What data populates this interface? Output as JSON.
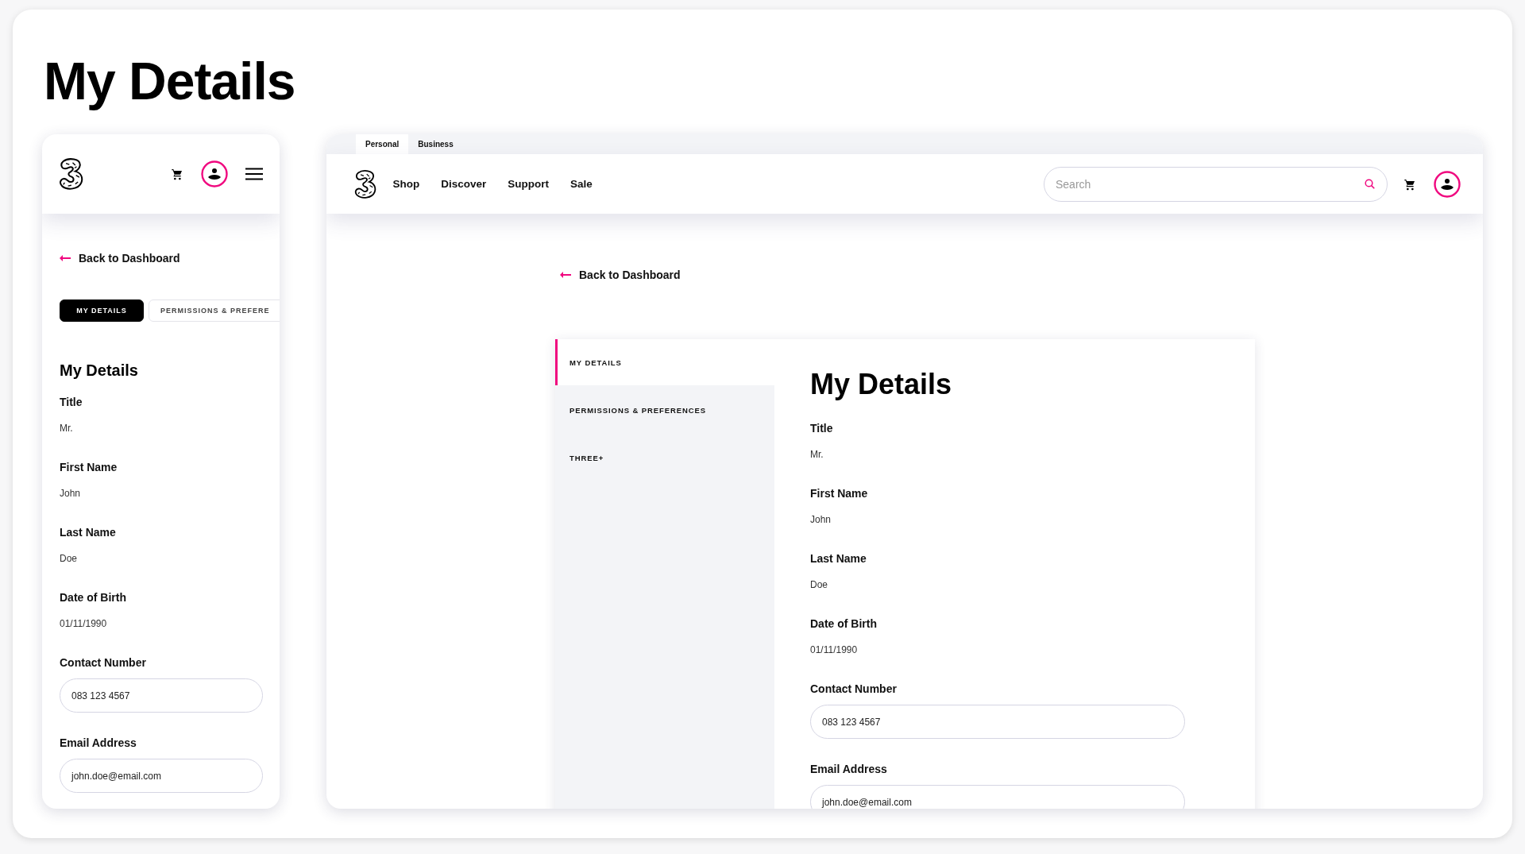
{
  "page_title": "My Details",
  "mobile": {
    "back_link": "Back to Dashboard",
    "tabs": [
      {
        "label": "MY DETAILS",
        "selected": true
      },
      {
        "label": "PERMISSIONS & PREFERE",
        "selected": false
      }
    ],
    "heading": "My Details",
    "fields": [
      {
        "kind": "text",
        "label": "Title",
        "value": "Mr."
      },
      {
        "kind": "text",
        "label": "First Name",
        "value": "John"
      },
      {
        "kind": "text",
        "label": "Last Name",
        "value": "Doe"
      },
      {
        "kind": "text",
        "label": "Date of Birth",
        "value": "01/11/1990"
      },
      {
        "kind": "input",
        "label": "Contact Number",
        "value": "083 123 4567"
      },
      {
        "kind": "input",
        "label": "Email Address",
        "value": "john.doe@email.com"
      }
    ]
  },
  "desktop": {
    "segments": [
      {
        "label": "Personal",
        "selected": true
      },
      {
        "label": "Business",
        "selected": false
      }
    ],
    "nav": [
      "Shop",
      "Discover",
      "Support",
      "Sale"
    ],
    "search": {
      "placeholder": "Search"
    },
    "back_link": "Back to Dashboard",
    "sidebar": [
      {
        "label": "MY DETAILS",
        "selected": true
      },
      {
        "label": "PERMISSIONS & PREFERENCES",
        "selected": false
      },
      {
        "label": "THREE+",
        "selected": false
      }
    ],
    "heading": "My Details",
    "fields": [
      {
        "kind": "text",
        "label": "Title",
        "value": "Mr."
      },
      {
        "kind": "text",
        "label": "First Name",
        "value": "John"
      },
      {
        "kind": "text",
        "label": "Last Name",
        "value": "Doe"
      },
      {
        "kind": "text",
        "label": "Date of Birth",
        "value": "01/11/1990"
      },
      {
        "kind": "input",
        "label": "Contact Number",
        "value": "083 123 4567"
      },
      {
        "kind": "input",
        "label": "Email Address",
        "value": "john.doe@email.com"
      }
    ]
  }
}
